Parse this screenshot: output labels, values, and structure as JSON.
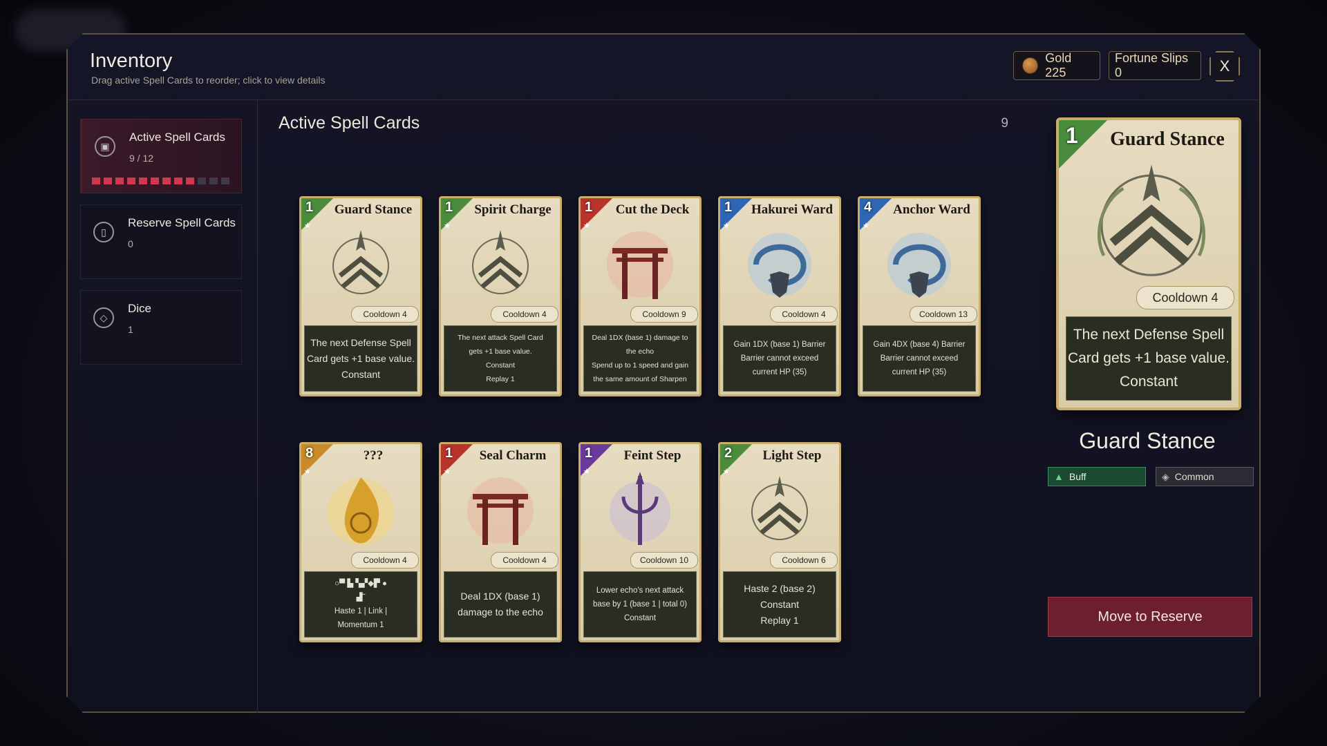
{
  "header": {
    "title": "Inventory",
    "subtitle": "Drag active Spell Cards to reorder; click to view details",
    "gold_label": "Gold 225",
    "fortune_label": "Fortune Slips 0",
    "close_label": "X"
  },
  "sidebar": {
    "items": [
      {
        "label": "Active Spell Cards",
        "count": "9 / 12"
      },
      {
        "label": "Reserve Spell Cards",
        "count": "0"
      },
      {
        "label": "Dice",
        "count": "1"
      }
    ],
    "active_pips_filled": 9,
    "active_pips_total": 12
  },
  "main": {
    "title": "Active Spell Cards",
    "count": "9"
  },
  "cards": [
    {
      "cost": "1",
      "name": "Guard Stance",
      "cooldown": "Cooldown 4",
      "color": "#4a8b3c",
      "desc": [
        "The next Defense Spell",
        "Card gets +1 base value.",
        "Constant"
      ]
    },
    {
      "cost": "1",
      "name": "Spirit Charge",
      "cooldown": "Cooldown 4",
      "color": "#4a8b3c",
      "desc": [
        "The next attack Spell Card",
        "gets +1 base value.",
        "Constant",
        "Replay 1"
      ]
    },
    {
      "cost": "1",
      "name": "Cut the Deck",
      "cooldown": "Cooldown 9",
      "color": "#b8332c",
      "desc": [
        "Deal 1DX (base 1) damage to",
        "the echo",
        "Spend up to 1 speed and gain",
        "the same amount of Sharpen"
      ]
    },
    {
      "cost": "1",
      "name": "Hakurei Ward",
      "cooldown": "Cooldown 4",
      "color": "#2f66b3",
      "desc": [
        "Gain 1DX (base 1) Barrier",
        "Barrier cannot exceed",
        "current HP (35)"
      ]
    },
    {
      "cost": "4",
      "name": "Anchor Ward",
      "cooldown": "Cooldown 13",
      "color": "#2f66b3",
      "desc": [
        "Gain 4DX (base 4) Barrier",
        "Barrier cannot exceed",
        "current HP (35)"
      ]
    },
    {
      "cost": "8",
      "name": "???",
      "cooldown": "Cooldown 4",
      "color": "#c98a2a",
      "desc": [
        "○▀ ▙ ▚▞◆▛ ●",
        "▟˜",
        "Haste 1 | Link |",
        "Momentum 1"
      ]
    },
    {
      "cost": "1",
      "name": "Seal Charm",
      "cooldown": "Cooldown 4",
      "color": "#b8332c",
      "desc": [
        "Deal 1DX (base 1)",
        "damage to the echo"
      ]
    },
    {
      "cost": "1",
      "name": "Feint Step",
      "cooldown": "Cooldown 10",
      "color": "#6a3a9c",
      "desc": [
        "Lower echo's next attack",
        "base by 1 (base 1 | total 0)",
        "Constant"
      ]
    },
    {
      "cost": "2",
      "name": "Light Step",
      "cooldown": "Cooldown 6",
      "color": "#4a8b3c",
      "desc": [
        "Haste 2 (base 2)",
        "Constant",
        "Replay 1"
      ]
    }
  ],
  "detail": {
    "cost": "1",
    "name": "Guard Stance",
    "card_name": "Guard Stance",
    "cooldown": "Cooldown 4",
    "desc": [
      "The next Defense Spell",
      "Card gets +1 base value.",
      "Constant"
    ],
    "tag_type": "Buff",
    "tag_rarity": "Common",
    "action_label": "Move to Reserve"
  }
}
